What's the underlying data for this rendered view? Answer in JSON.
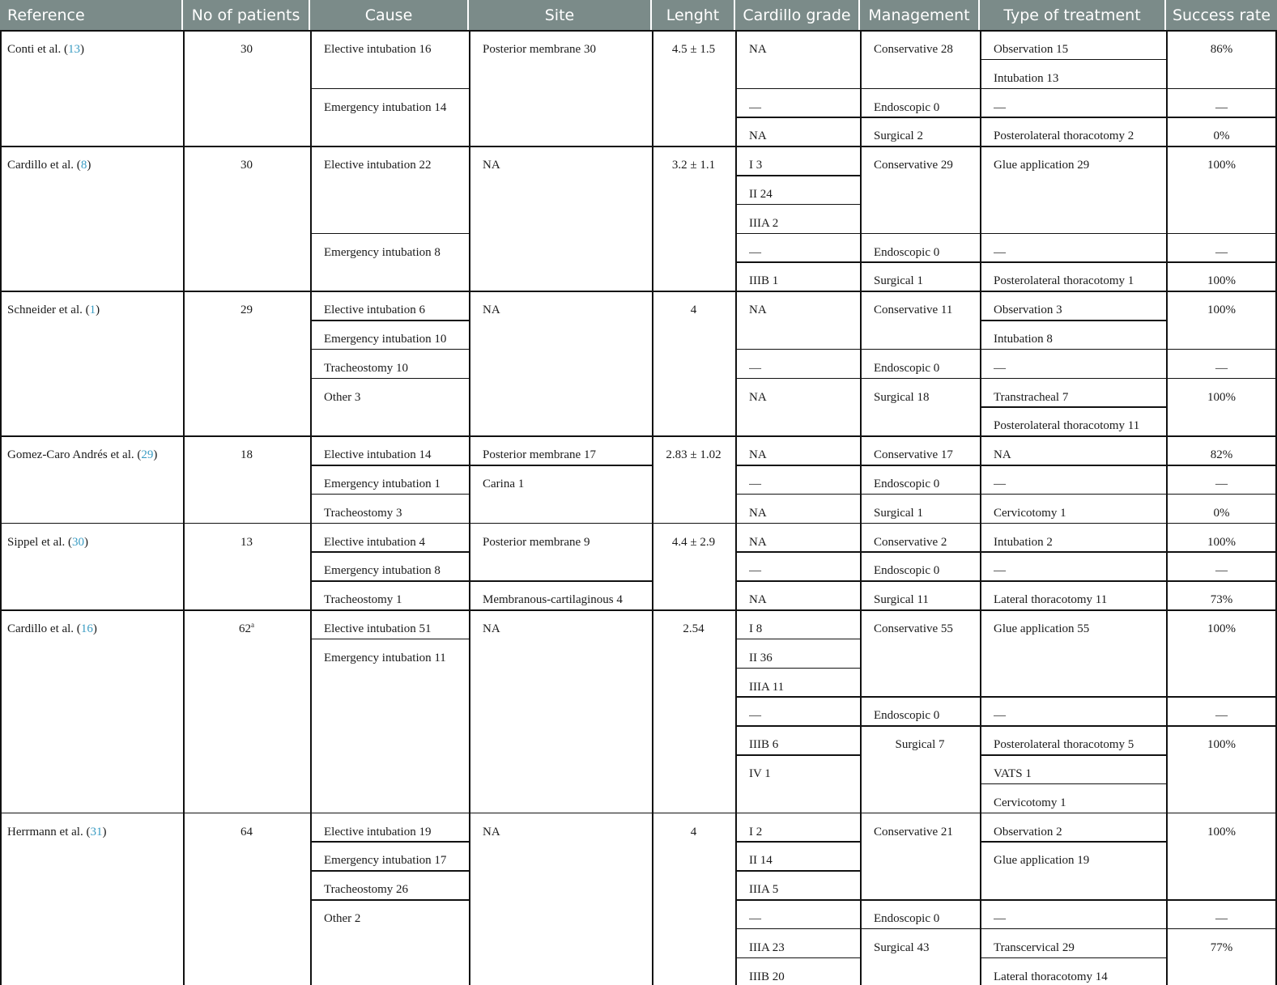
{
  "columns": [
    "Reference",
    "No of patients",
    "Cause",
    "Site",
    "Lenght",
    "Cardillo grade",
    "Management",
    "Type of treatment",
    "Success rate"
  ],
  "studies": [
    {
      "reference": "Conti et al. (",
      "citation": "13",
      "reference_end": ")",
      "patients": "30",
      "patients_sup": "",
      "causes": [
        "Elective intubation 16",
        "Emergency intubation 14"
      ],
      "sites": [
        "Posterior membrane 30"
      ],
      "length": "4.5 ± 1.5",
      "grades": [
        "NA",
        "—",
        "NA"
      ],
      "management": [
        "Conservative 28",
        "Endoscopic 0",
        "Surgical 2"
      ],
      "treatments": [
        "Observation 15",
        "Intubation 13",
        "—",
        "Posterolateral thoracotomy 2"
      ],
      "success": [
        "86%",
        "—",
        "0%"
      ]
    },
    {
      "reference": "Cardillo et al. (",
      "citation": "8",
      "reference_end": ")",
      "patients": "30",
      "patients_sup": "",
      "causes": [
        "Elective intubation 22",
        "Emergency intubation 8"
      ],
      "sites": [
        "NA"
      ],
      "length": "3.2 ± 1.1",
      "grades": [
        "I 3",
        "II 24",
        "IIIA 2",
        "—",
        "IIIB 1"
      ],
      "management": [
        "Conservative 29",
        "Endoscopic 0",
        "Surgical 1"
      ],
      "treatments": [
        "Glue application 29",
        "—",
        "Posterolateral thoracotomy 1"
      ],
      "success": [
        "100%",
        "—",
        "100%"
      ]
    },
    {
      "reference": "Schneider et al. (",
      "citation": "1",
      "reference_end": ")",
      "patients": "29",
      "patients_sup": "",
      "causes": [
        "Elective intubation 6",
        "Emergency intubation 10",
        "Tracheostomy 10",
        "Other 3"
      ],
      "sites": [
        "NA"
      ],
      "length": "4",
      "grades": [
        "NA",
        "—",
        "NA"
      ],
      "management": [
        "Conservative 11",
        "Endoscopic 0",
        "Surgical 18"
      ],
      "treatments": [
        "Observation 3",
        "Intubation 8",
        "—",
        "Transtracheal 7",
        "Posterolateral thoracotomy 11"
      ],
      "success": [
        "100%",
        "—",
        "100%"
      ]
    },
    {
      "reference": "Gomez-Caro Andrés et al. (",
      "citation": "29",
      "reference_end": ")",
      "patients": "18",
      "patients_sup": "",
      "causes": [
        "Elective intubation 14",
        "Emergency intubation 1",
        "Tracheostomy 3"
      ],
      "sites": [
        "Posterior membrane 17",
        "Carina 1"
      ],
      "length": "2.83 ± 1.02",
      "grades": [
        "NA",
        "—",
        "NA"
      ],
      "management": [
        "Conservative 17",
        "Endoscopic 0",
        "Surgical 1"
      ],
      "treatments": [
        "NA",
        "—",
        "Cervicotomy 1"
      ],
      "success": [
        "82%",
        "—",
        "0%"
      ]
    },
    {
      "reference": "Sippel et al. (",
      "citation": "30",
      "reference_end": ")",
      "patients": "13",
      "patients_sup": "",
      "causes": [
        "Elective intubation 4",
        "Emergency intubation 8",
        "Tracheostomy 1"
      ],
      "sites": [
        "Posterior membrane 9",
        "Membranous-cartilaginous 4"
      ],
      "length": "4.4 ± 2.9",
      "grades": [
        "NA",
        "—",
        "NA"
      ],
      "management": [
        "Conservative 2",
        "Endoscopic 0",
        "Surgical 11"
      ],
      "treatments": [
        "Intubation 2",
        "—",
        "Lateral thoracotomy 11"
      ],
      "success": [
        "100%",
        "—",
        "73%"
      ]
    },
    {
      "reference": "Cardillo et al. (",
      "citation": "16",
      "reference_end": ")",
      "patients": "62",
      "patients_sup": "a",
      "causes": [
        "Elective intubation 51",
        "Emergency intubation 11"
      ],
      "sites": [
        "NA"
      ],
      "length": "2.54",
      "grades": [
        "I 8",
        "II 36",
        "IIIA 11",
        "—",
        "IIIB 6",
        "IV 1"
      ],
      "management": [
        "Conservative 55",
        "Endoscopic 0",
        "Surgical 7"
      ],
      "treatments": [
        "Glue application 55",
        "—",
        "Posterolateral thoracotomy 5",
        "VATS 1",
        "Cervicotomy 1"
      ],
      "success": [
        "100%",
        "—",
        "100%"
      ]
    },
    {
      "reference": "Herrmann et al. (",
      "citation": "31",
      "reference_end": ")",
      "patients": "64",
      "patients_sup": "",
      "causes": [
        "Elective intubation 19",
        "Emergency intubation 17",
        "Tracheostomy 26",
        "Other 2"
      ],
      "sites": [
        "NA"
      ],
      "length": "4",
      "grades": [
        "I 2",
        "II 14",
        "IIIA 5",
        "—",
        "IIIA 23",
        "IIIB 20"
      ],
      "management": [
        "Conservative 21",
        "Endoscopic 0",
        "Surgical 43"
      ],
      "treatments": [
        "Observation 2",
        "Glue application 19",
        "—",
        "Transcervical 29",
        "Lateral thoracotomy 14"
      ],
      "success": [
        "100%",
        "—",
        "77%"
      ]
    }
  ]
}
